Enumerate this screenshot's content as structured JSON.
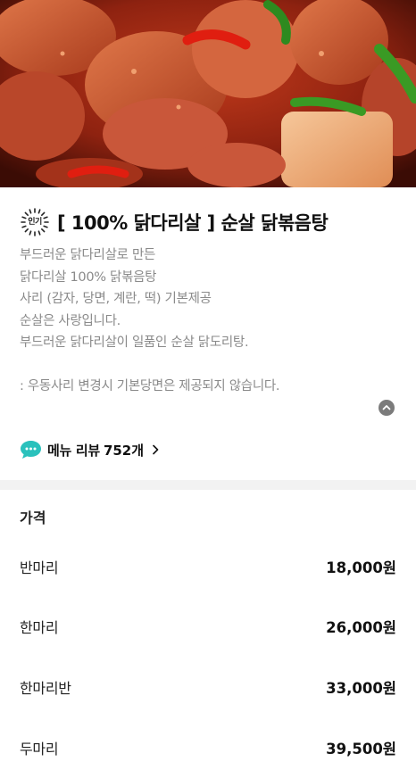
{
  "hero": {
    "image": "spicy-braised-chicken-photo"
  },
  "menu": {
    "badge_text": "인기",
    "title": "[ 100% 닭다리살 ] 순살 닭볶음탕",
    "description_lines": [
      "부드러운 닭다리살로 만든",
      "닭다리살 100% 닭볶음탕",
      "사리 (감자, 당면, 계란, 떡) 기본제공",
      "순살은 사랑입니다.",
      "부드러운 닭다리살이 일품인 순살 닭도리탕.",
      "",
      ": 우동사리 변경시 기본당면은 제공되지 않습니다."
    ],
    "collapse_icon": "chevron-up-icon"
  },
  "review": {
    "icon": "speech-bubble-icon",
    "label": "메뉴 리뷰",
    "count": "752개",
    "chevron": "chevron-right-icon",
    "accent_color": "#2ac1bc"
  },
  "price": {
    "heading": "가격",
    "options": [
      {
        "name": "반마리",
        "price": "18,000원"
      },
      {
        "name": "한마리",
        "price": "26,000원"
      },
      {
        "name": "한마리반",
        "price": "33,000원"
      },
      {
        "name": "두마리",
        "price": "39,500원"
      }
    ]
  }
}
